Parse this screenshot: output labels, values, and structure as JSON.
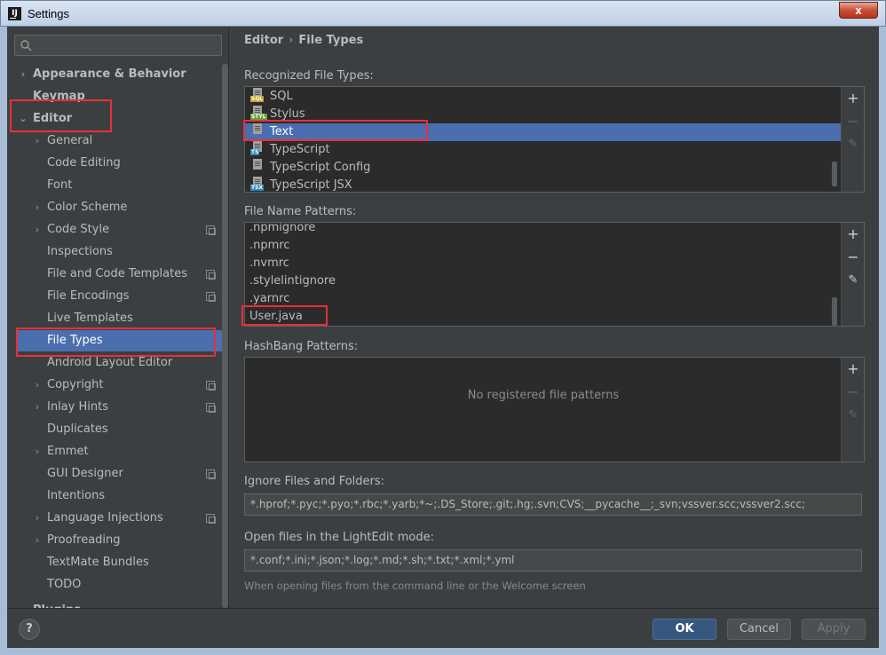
{
  "window": {
    "title": "Settings",
    "close_label": "x"
  },
  "sidebar": {
    "search_placeholder": "",
    "items": [
      {
        "label": "Appearance & Behavior",
        "chevron": "›"
      },
      {
        "label": "Keymap",
        "chevron": ""
      },
      {
        "label": "Editor",
        "chevron": "⌄"
      },
      {
        "label": "General",
        "chevron": "›"
      },
      {
        "label": "Code Editing",
        "chevron": ""
      },
      {
        "label": "Font",
        "chevron": ""
      },
      {
        "label": "Color Scheme",
        "chevron": "›"
      },
      {
        "label": "Code Style",
        "chevron": "›"
      },
      {
        "label": "Inspections",
        "chevron": ""
      },
      {
        "label": "File and Code Templates",
        "chevron": ""
      },
      {
        "label": "File Encodings",
        "chevron": ""
      },
      {
        "label": "Live Templates",
        "chevron": ""
      },
      {
        "label": "File Types",
        "chevron": ""
      },
      {
        "label": "Android Layout Editor",
        "chevron": ""
      },
      {
        "label": "Copyright",
        "chevron": "›"
      },
      {
        "label": "Inlay Hints",
        "chevron": "›"
      },
      {
        "label": "Duplicates",
        "chevron": ""
      },
      {
        "label": "Emmet",
        "chevron": "›"
      },
      {
        "label": "GUI Designer",
        "chevron": ""
      },
      {
        "label": "Intentions",
        "chevron": ""
      },
      {
        "label": "Language Injections",
        "chevron": "›"
      },
      {
        "label": "Proofreading",
        "chevron": "›"
      },
      {
        "label": "TextMate Bundles",
        "chevron": ""
      },
      {
        "label": "TODO",
        "chevron": ""
      },
      {
        "label": "Plugins",
        "chevron": ""
      }
    ]
  },
  "main": {
    "breadcrumb": {
      "parent": "Editor",
      "separator": "›",
      "current": "File Types"
    },
    "recognized": {
      "label": "Recognized File Types:",
      "items": [
        {
          "name": "SQL",
          "tag": "SQL",
          "tag_color": "#c9a227"
        },
        {
          "name": "Stylus",
          "tag": "STYL",
          "tag_color": "#6a9f3a"
        },
        {
          "name": "Text",
          "tag": "",
          "tag_color": ""
        },
        {
          "name": "TypeScript",
          "tag": "TS",
          "tag_color": "#2f8bb8"
        },
        {
          "name": "TypeScript Config",
          "tag": "",
          "tag_color": ""
        },
        {
          "name": "TypeScript JSX",
          "tag": "TSX",
          "tag_color": "#2f8bb8"
        }
      ]
    },
    "patterns": {
      "label": "File Name Patterns:",
      "items": [
        ".npmignore",
        ".npmrc",
        ".nvmrc",
        ".stylelintignore",
        ".yarnrc",
        "User.java"
      ]
    },
    "hashbang": {
      "label": "HashBang Patterns:",
      "empty_text": "No registered file patterns"
    },
    "ignore": {
      "label": "Ignore Files and Folders:",
      "value": "*.hprof;*.pyc;*.pyo;*.rbc;*.yarb;*~;.DS_Store;.git;.hg;.svn;CVS;__pycache__;_svn;vssver.scc;vssver2.scc;"
    },
    "lightedit": {
      "label": "Open files in the LightEdit mode:",
      "value": "*.conf;*.ini;*.json;*.log;*.md;*.sh;*.txt;*.xml;*.yml",
      "hint": "When opening files from the command line or the Welcome screen"
    },
    "tools": {
      "add": "+",
      "remove": "−",
      "edit": "✎"
    }
  },
  "footer": {
    "help": "?",
    "ok": "OK",
    "cancel": "Cancel",
    "apply": "Apply"
  },
  "colors": {
    "selection": "#4b6eaf",
    "highlight_box": "#e8303a",
    "primary_button": "#365880"
  }
}
